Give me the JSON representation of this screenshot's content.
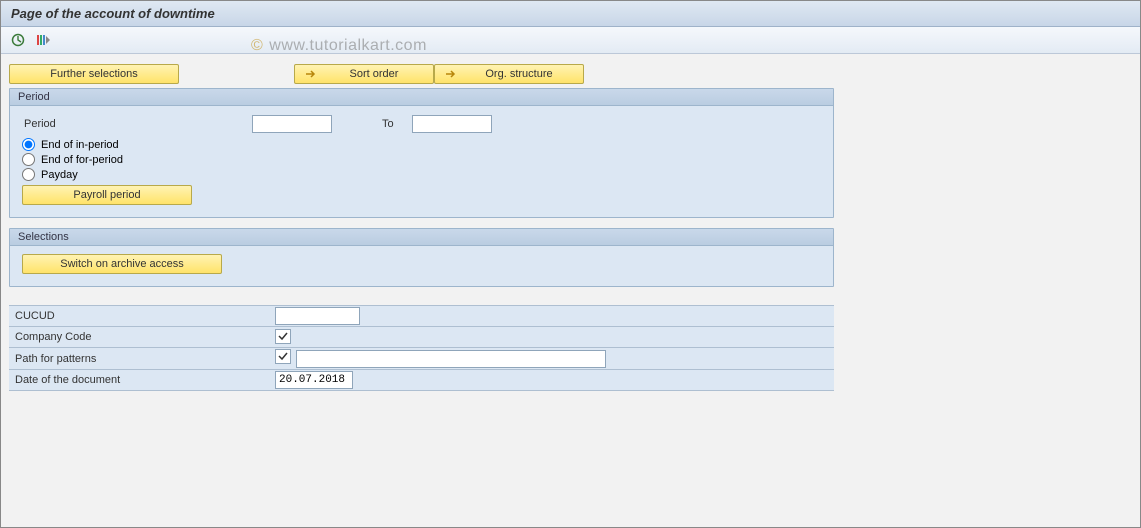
{
  "title": "Page of the account of downtime",
  "watermark": "www.tutorialkart.com",
  "buttons": {
    "further": "Further selections",
    "sort": "Sort order",
    "org": "Org. structure"
  },
  "period": {
    "group_title": "Period",
    "label": "Period",
    "to_label": "To",
    "from_value": "",
    "to_value": "",
    "radio_in": "End of in-period",
    "radio_for": "End of for-period",
    "radio_payday": "Payday",
    "payroll_btn": "Payroll period"
  },
  "selections": {
    "group_title": "Selections",
    "archive_btn": "Switch on archive access"
  },
  "params": {
    "cucud": {
      "label": "CUCUD",
      "value": ""
    },
    "company": {
      "label": "Company Code",
      "checked": true
    },
    "patterns": {
      "label": "Path for patterns",
      "checked": true,
      "value": ""
    },
    "docdate": {
      "label": "Date of the document",
      "value": "20.07.2018"
    }
  }
}
